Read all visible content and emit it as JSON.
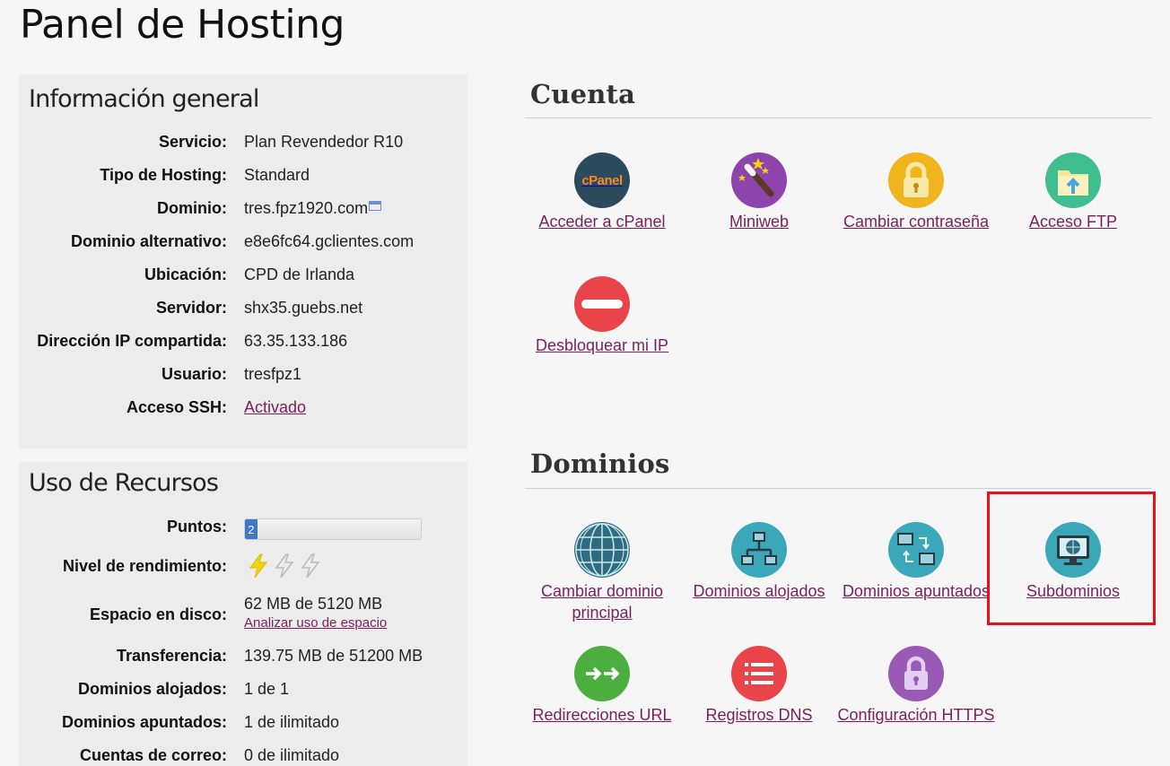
{
  "page": {
    "title": "Panel de Hosting"
  },
  "info": {
    "heading": "Información general",
    "rows": [
      {
        "label": "Servicio:",
        "value": "Plan Revendedor R10"
      },
      {
        "label": "Tipo de Hosting:",
        "value": "Standard"
      },
      {
        "label": "Dominio:",
        "value": "tres.fpz1920.com"
      },
      {
        "label": "Dominio alternativo:",
        "value": "e8e6fc64.gclientes.com"
      },
      {
        "label": "Ubicación:",
        "value": "CPD de Irlanda"
      },
      {
        "label": "Servidor:",
        "value": "shx35.guebs.net"
      },
      {
        "label": "Dirección IP compartida:",
        "value": "63.35.133.186"
      },
      {
        "label": "Usuario:",
        "value": "tresfpz1"
      },
      {
        "label": "Acceso SSH:",
        "value": "Activado"
      }
    ]
  },
  "resources": {
    "heading": "Uso de Recursos",
    "points": {
      "label": "Puntos:",
      "value": "2",
      "fill_fraction": 0.07
    },
    "performance": {
      "label": "Nivel de rendimiento:",
      "level": 1,
      "max": 3,
      "icon": "lightning-bolt-icon"
    },
    "disk": {
      "label": "Espacio en disco:",
      "value": "62 MB de 5120 MB",
      "link": "Analizar uso de espacio"
    },
    "transfer": {
      "label": "Transferencia:",
      "value": "139.75 MB de 51200 MB"
    },
    "hosted": {
      "label": "Dominios alojados:",
      "value": "1 de 1"
    },
    "pointed": {
      "label": "Dominios apuntados:",
      "value": "1 de ilimitado"
    },
    "mail": {
      "label": "Cuentas de correo:",
      "value": "0 de ilimitado"
    }
  },
  "cuenta": {
    "heading": "Cuenta",
    "tiles": [
      {
        "label": "Acceder a cPanel",
        "icon": "cpanel-icon",
        "icon_text": "cPanel",
        "color": "#2d4a5c"
      },
      {
        "label": "Miniweb",
        "icon": "magic-wand-icon",
        "color": "#8e44ad"
      },
      {
        "label": "Cambiar contraseña",
        "icon": "padlock-icon",
        "color": "#f0b41c"
      },
      {
        "label": "Acceso FTP",
        "icon": "folder-upload-icon",
        "color": "#3fbf8f"
      },
      {
        "label": "Desbloquear mi IP",
        "icon": "no-entry-icon",
        "color": "#e8444a"
      }
    ]
  },
  "dominios": {
    "heading": "Dominios",
    "tiles": [
      {
        "label": "Cambiar dominio principal",
        "icon": "globe-icon",
        "color": "#2e6d80"
      },
      {
        "label": "Dominios alojados",
        "icon": "network-icon",
        "color": "#3aa8b8"
      },
      {
        "label": "Dominios apuntados",
        "icon": "monitors-sync-icon",
        "color": "#3aa8b8"
      },
      {
        "label": "Subdominios",
        "icon": "monitor-globe-icon",
        "color": "#3aa8b8"
      },
      {
        "label": "Redirecciones URL",
        "icon": "arrows-right-icon",
        "color": "#4cae3e"
      },
      {
        "label": "Registros DNS",
        "icon": "list-icon",
        "color": "#e8444a"
      },
      {
        "label": "Configuración HTTPS",
        "icon": "padlock-icon",
        "color": "#9b59b6"
      }
    ]
  },
  "colors": {
    "link": "#7a1f5a",
    "highlight": "#e8101a",
    "points_bar": "#3b78c7"
  }
}
